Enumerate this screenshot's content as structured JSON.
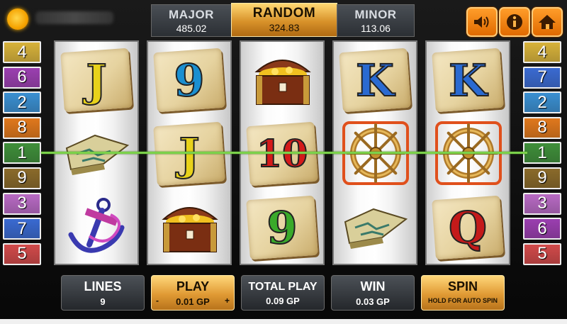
{
  "jackpots": {
    "major": {
      "label": "MAJOR",
      "value": "485.02"
    },
    "random": {
      "label": "RANDOM",
      "value": "324.83"
    },
    "minor": {
      "label": "MINOR",
      "value": "113.06"
    }
  },
  "top_buttons": [
    "sound-icon",
    "info-icon",
    "home-icon"
  ],
  "lines_left": [
    {
      "n": "4",
      "color": "#d7b23a"
    },
    {
      "n": "6",
      "color": "#9b3fb0"
    },
    {
      "n": "2",
      "color": "#3a8fd1"
    },
    {
      "n": "8",
      "color": "#e0781c"
    },
    {
      "n": "1",
      "color": "#3f8f3a"
    },
    {
      "n": "9",
      "color": "#8a6a2a"
    },
    {
      "n": "3",
      "color": "#b86ac4"
    },
    {
      "n": "7",
      "color": "#3a6ad1"
    },
    {
      "n": "5",
      "color": "#d14a4a"
    }
  ],
  "lines_right": [
    {
      "n": "4",
      "color": "#d7b23a"
    },
    {
      "n": "7",
      "color": "#3a6ad1"
    },
    {
      "n": "2",
      "color": "#3a8fd1"
    },
    {
      "n": "8",
      "color": "#e0781c"
    },
    {
      "n": "1",
      "color": "#3f8f3a"
    },
    {
      "n": "9",
      "color": "#8a6a2a"
    },
    {
      "n": "3",
      "color": "#b86ac4"
    },
    {
      "n": "6",
      "color": "#9b3fb0"
    },
    {
      "n": "5",
      "color": "#d14a4a"
    }
  ],
  "reels": [
    [
      {
        "sym": "J",
        "color": "#e8d21a"
      },
      {
        "sym": "map",
        "color": ""
      },
      {
        "sym": "anchor",
        "color": ""
      }
    ],
    [
      {
        "sym": "9",
        "color": "#1a8fd1"
      },
      {
        "sym": "J",
        "color": "#e8d21a"
      },
      {
        "sym": "chest",
        "color": ""
      }
    ],
    [
      {
        "sym": "chest",
        "color": ""
      },
      {
        "sym": "10",
        "color": "#d41a1a"
      },
      {
        "sym": "9",
        "color": "#3aaa2a"
      }
    ],
    [
      {
        "sym": "K",
        "color": "#2a6ad1"
      },
      {
        "sym": "wheel",
        "color": ""
      },
      {
        "sym": "map",
        "color": ""
      }
    ],
    [
      {
        "sym": "K",
        "color": "#2a6ad1"
      },
      {
        "sym": "wheel",
        "color": ""
      },
      {
        "sym": "Q",
        "color": "#c41a1a"
      }
    ]
  ],
  "controls": {
    "lines": {
      "label": "LINES",
      "value": "9"
    },
    "play": {
      "label": "PLAY",
      "value": "0.01 GP",
      "minus": "-",
      "plus": "+"
    },
    "total_play": {
      "label": "TOTAL PLAY",
      "value": "0.09 GP"
    },
    "win": {
      "label": "WIN",
      "value": "0.03 GP"
    },
    "spin": {
      "label": "SPIN",
      "sub": "HOLD FOR AUTO SPIN"
    }
  },
  "colors": {
    "accent": "#e07a0e",
    "gold": "#e09a34",
    "payline": "#7bd14a",
    "highlight": "#e0501c"
  }
}
